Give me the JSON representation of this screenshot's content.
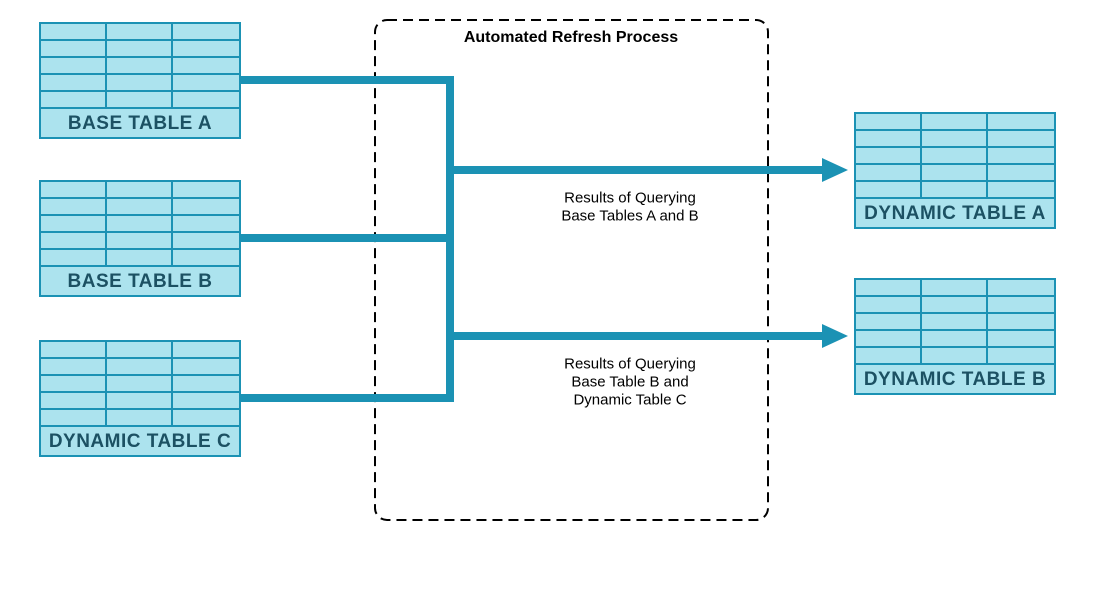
{
  "process": {
    "title": "Automated Refresh Process",
    "result_a_line1": "Results of Querying",
    "result_a_line2": "Base Tables A and B",
    "result_b_line1": "Results of Querying",
    "result_b_line2": "Base Table B and",
    "result_b_line3": "Dynamic Table C"
  },
  "tables": {
    "base_a": "BASE TABLE A",
    "base_b": "BASE TABLE B",
    "dyn_c": "DYNAMIC TABLE C",
    "dyn_a": "DYNAMIC TABLE A",
    "dyn_b": "DYNAMIC TABLE B"
  },
  "colors": {
    "table_fill": "#ace3ee",
    "table_stroke": "#1b92b4",
    "flow": "#1b92b4",
    "text_dark": "#1c5163"
  }
}
